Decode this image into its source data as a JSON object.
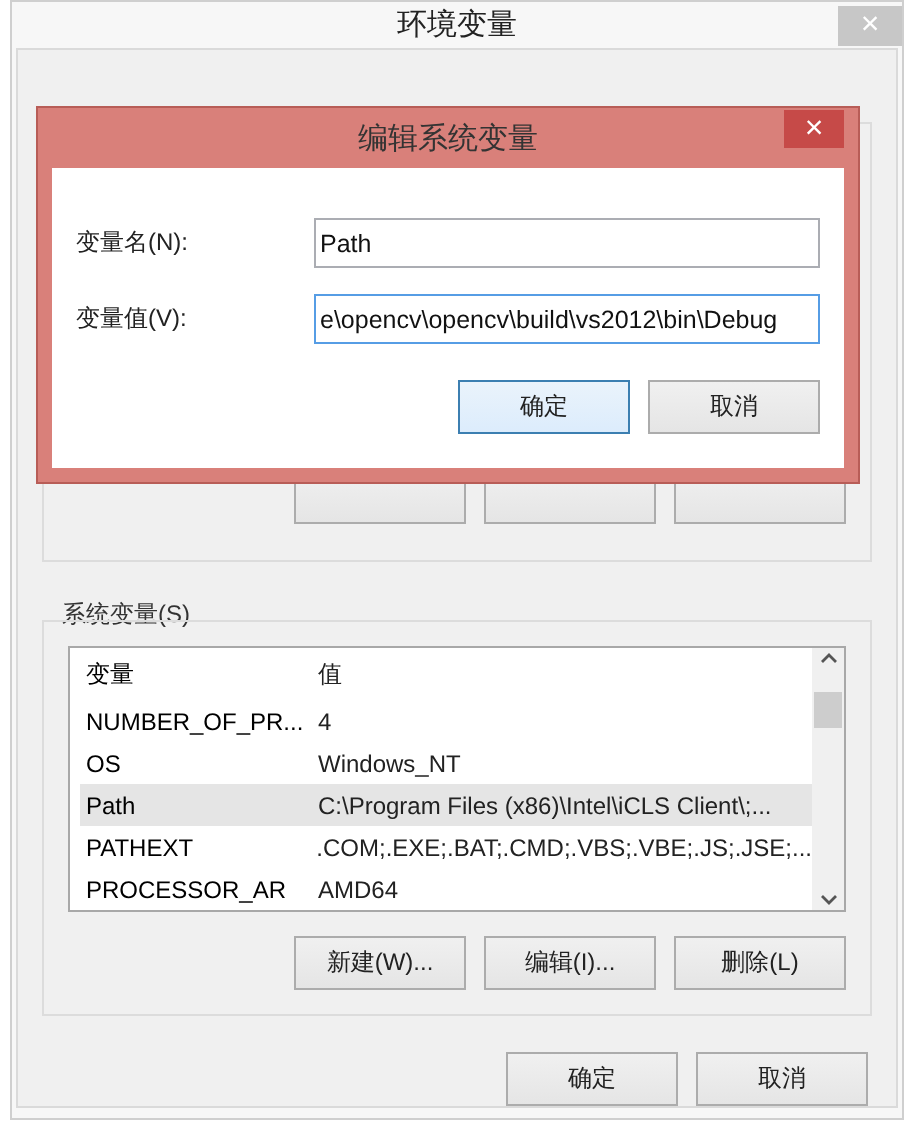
{
  "window": {
    "title": "环境变量",
    "close": "×"
  },
  "system_variables": {
    "label": "系统变量(S)",
    "columns": [
      "变量",
      "值"
    ],
    "rows": [
      {
        "name": "NUMBER_OF_PR...",
        "value": "4",
        "selected": false
      },
      {
        "name": "OS",
        "value": "Windows_NT",
        "selected": false
      },
      {
        "name": "Path",
        "value": "C:\\Program Files (x86)\\Intel\\iCLS Client\\;...",
        "selected": true
      },
      {
        "name": "PATHEXT",
        "value": ".COM;.EXE;.BAT;.CMD;.VBS;.VBE;.JS;.JSE;...",
        "selected": false
      },
      {
        "name": "PROCESSOR_AR",
        "value": "AMD64",
        "selected": false
      }
    ],
    "buttons": [
      "新建(W)...",
      "编辑(I)...",
      "删除(L)"
    ]
  },
  "buttons": [
    {
      "label": "确定",
      "focused": false
    },
    {
      "label": "取消",
      "focused": false
    }
  ],
  "dialog": {
    "title": "编辑系统变量",
    "close": "×",
    "fields": [
      {
        "label": "变量名(N):",
        "value": "Path"
      },
      {
        "label": "变量值(V):",
        "value": "e\\opencv\\opencv\\build\\vs2012\\bin\\Debug"
      }
    ],
    "buttons": [
      {
        "label": "确定",
        "focused": true
      },
      {
        "label": "取消",
        "focused": false
      }
    ]
  }
}
